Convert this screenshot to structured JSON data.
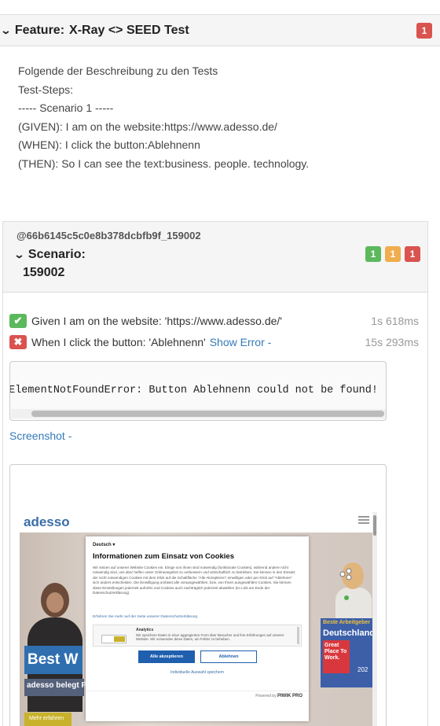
{
  "feature": {
    "keyword": "Feature:",
    "title": "X-Ray <> SEED Test",
    "badge": "1",
    "description": [
      "Folgende der Beschreibung zu den Tests",
      "",
      "Test-Steps:",
      "",
      "----- Scenario 1 -----",
      "(GIVEN): I am on the website:https://www.adesso.de/",
      "(WHEN): I click the button:Ablehnenn",
      "(THEN): So I can see the text:business. people. technology."
    ]
  },
  "scenario": {
    "id": "@66b6145c5c0e8b378dcbfb9f_159002",
    "label": "Scenario:",
    "name": "159002",
    "badges": {
      "passed": "1",
      "skipped": "1",
      "failed": "1"
    }
  },
  "steps": [
    {
      "status": "passed",
      "keyword": "Given",
      "text": "I am on the website: 'https://www.adesso.de/'",
      "duration": "1s 618ms"
    },
    {
      "status": "failed",
      "keyword": "When",
      "text": "I click the button: 'Ablehnenn'",
      "link": "Show Error -",
      "duration": "15s 293ms"
    }
  ],
  "error": {
    "message": "ElementNotFoundError: Button Ablehnenn could not be found!"
  },
  "screenshot_link": "Screenshot -",
  "screenshot": {
    "logo": "adesso",
    "hero_banner": "Best W",
    "hero_sub": "adesso belegt P",
    "hero_button": "Mehr erfahren",
    "award_line1": "Beste Arbeitgeber",
    "award_line2": "Deutschland",
    "award_badge": "Great Place To Work.",
    "award_year": "202",
    "consent": {
      "language": "Deutsch ▾",
      "title": "Informationen zum Einsatz von Cookies",
      "body": "Wir setzen auf unserer Website Cookies ein. Einige von ihnen sind notwendig (funktionale Cookies), während andere nicht notwendig sind, uns aber helfen unser Onlineangebot zu verbessern und wirtschaftlich zu betreiben. Sie können in den Einsatz der nicht notwendigen Cookies mit dem Klick auf die Schaltfläche \"Alle Akzeptieren\" einwilligen oder per Klick auf \"Ablehnen\" sich anders entscheiden. Die Einwilligung umfasst alle vorausgewählten, bzw. von Ihnen ausgewählten Cookies. Sie können diese Einstellungen jederzeit aufrufen und Cookies auch nachträglich jederzeit abwählen (im Link am Ende der Datenschutzerklärung).",
      "link": "Erfahren Sie mehr auf der Seite unserer Datenschutzerklärung",
      "category_title": "Analytics",
      "category_text": "Wir speichern Daten in einer aggregierten Form über Besucher und ihre Erfahrungen auf unserer Website. Wir verwenden diese Daten, um Fehler zu beheben.",
      "accept_label": "Alle akzeptieren",
      "reject_label": "Ablehnen",
      "save_label": "Individuelle Auswahl speichern",
      "powered_label": "Powered by",
      "powered_brand": "PIWIK PRO"
    }
  },
  "colors": {
    "pass": "#5cb85c",
    "skip": "#f0ad4e",
    "fail": "#d9534f",
    "link": "#337ab7"
  }
}
